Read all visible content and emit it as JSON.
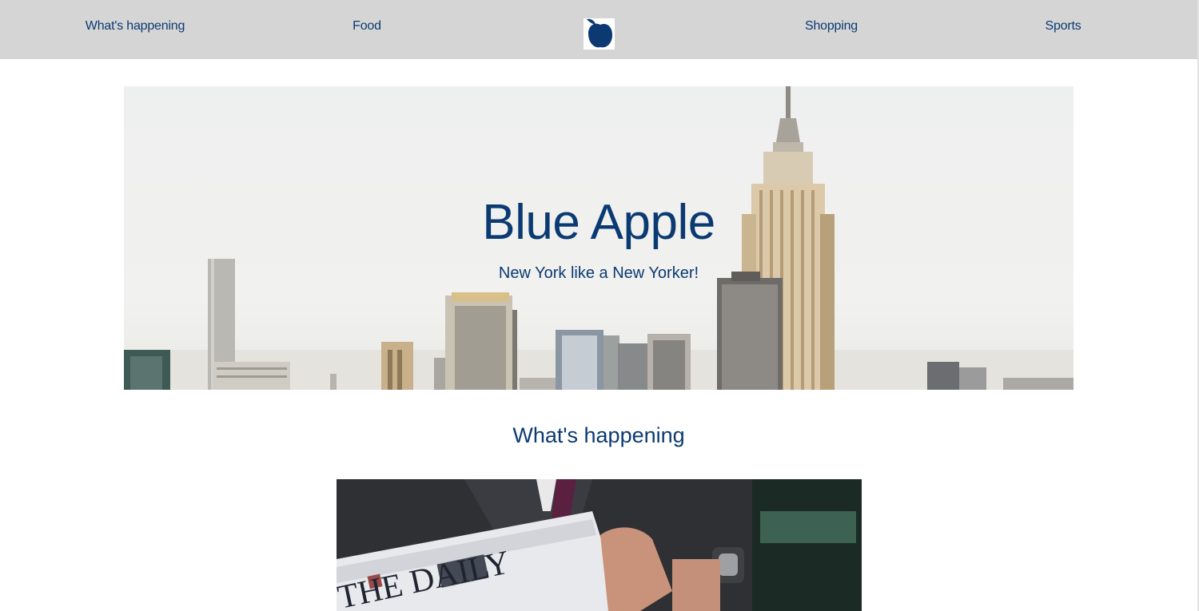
{
  "nav": {
    "items": [
      {
        "label": "What's happening"
      },
      {
        "label": "Food"
      },
      {
        "label": "Shopping"
      },
      {
        "label": "Sports"
      }
    ],
    "logo_icon": "blue-apple-icon",
    "background": "#d5d5d5",
    "link_color": "#0b3a72"
  },
  "hero": {
    "title": "Blue Apple",
    "subtitle": "New York like a New Yorker!"
  },
  "section": {
    "title": "What's happening",
    "image_newspaper_headline": "THE DAILY"
  },
  "colors": {
    "brand": "#0b3a72",
    "page_bg": "#ffffff"
  }
}
